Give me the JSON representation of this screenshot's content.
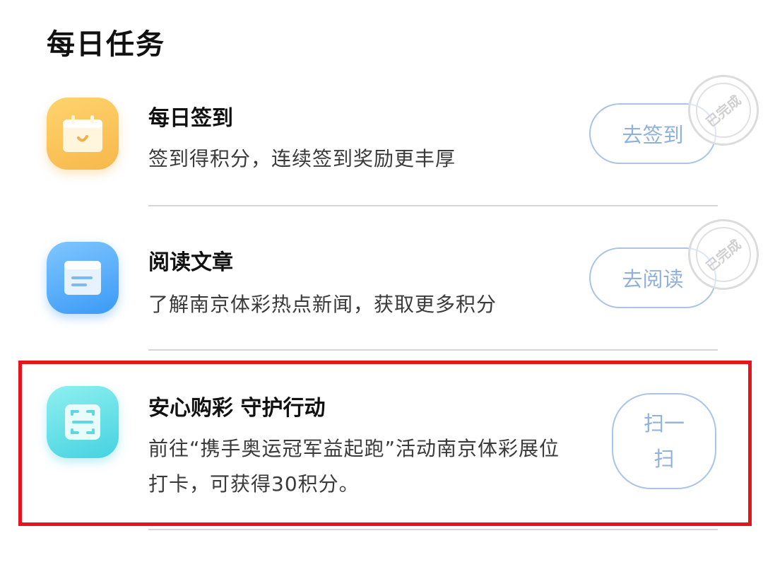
{
  "page": {
    "title": "每日任务"
  },
  "tasks": [
    {
      "title": "每日签到",
      "desc": "签到得积分，连续签到奖励更丰厚",
      "action": "去签到",
      "stamp": "已完成",
      "icon": "calendar-icon",
      "color": "#f7b84a"
    },
    {
      "title": "阅读文章",
      "desc": "了解南京体彩热点新闻，获取更多积分",
      "action": "去阅读",
      "stamp": "已完成",
      "icon": "document-icon",
      "color": "#3b9af5"
    },
    {
      "title": "安心购彩 守护行动",
      "desc_line1": "前往“携手奥运冠军益起跑”活动南京体彩展位",
      "desc_line2": "打卡，可获得30积分。",
      "action_line1": "扫一",
      "action_line2": "扫",
      "icon": "scan-icon",
      "color": "#45d2e0"
    }
  ],
  "highlight_color": "#e8141c",
  "button_color": "#a9c4e6"
}
